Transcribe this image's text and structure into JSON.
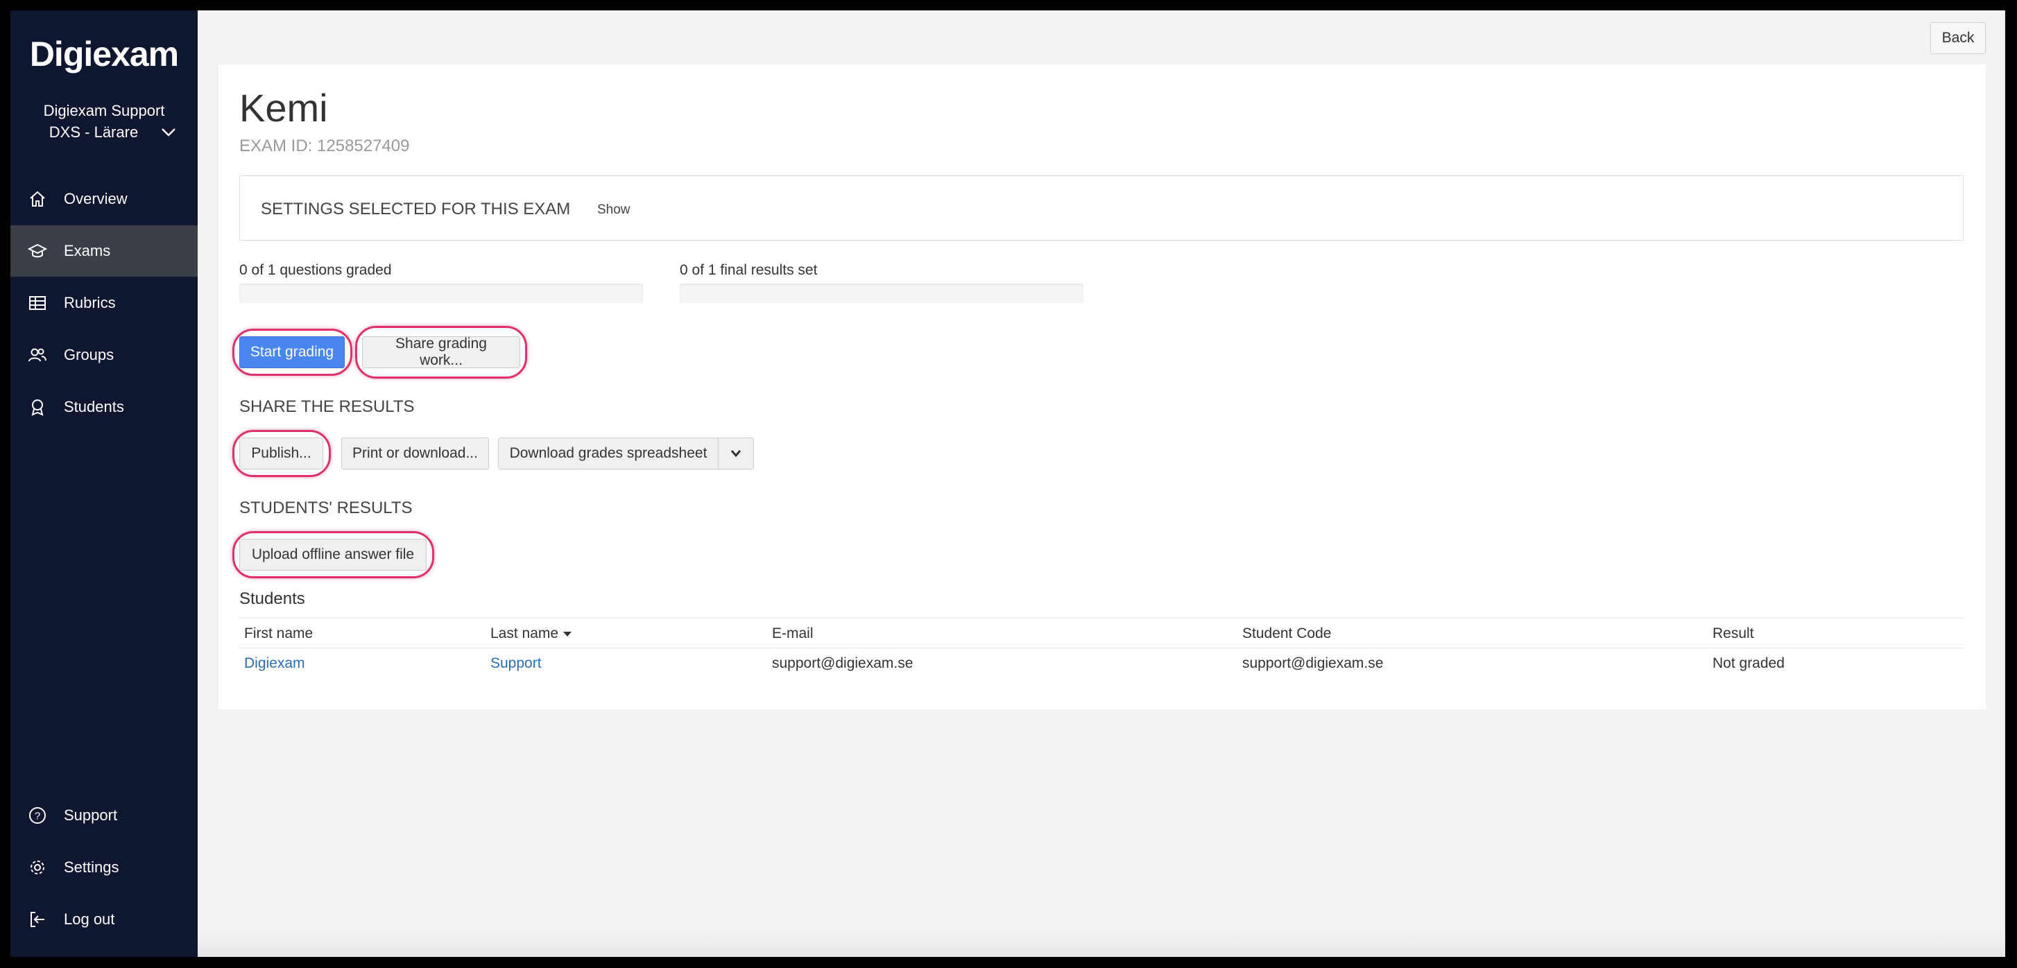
{
  "sidebar": {
    "logo": "Digiexam",
    "account_name": "Digiexam Support",
    "account_role": "DXS - Lärare",
    "nav": [
      {
        "label": "Overview",
        "icon": "home-icon"
      },
      {
        "label": "Exams",
        "icon": "graduation-cap-icon",
        "active": true
      },
      {
        "label": "Rubrics",
        "icon": "table-icon"
      },
      {
        "label": "Groups",
        "icon": "users-icon"
      },
      {
        "label": "Students",
        "icon": "student-icon"
      }
    ],
    "bottom_nav": [
      {
        "label": "Support",
        "icon": "help-icon"
      },
      {
        "label": "Settings",
        "icon": "gear-icon"
      },
      {
        "label": "Log out",
        "icon": "logout-icon"
      }
    ]
  },
  "header": {
    "back_label": "Back"
  },
  "exam": {
    "title": "Kemi",
    "id_text": "EXAM ID: 1258527409"
  },
  "settings": {
    "title": "SETTINGS SELECTED FOR THIS EXAM",
    "show_label": "Show"
  },
  "progress": {
    "questions_label": "0 of 1 questions graded",
    "questions_fraction": 0,
    "results_label": "0 of 1 final results set",
    "results_fraction": 0
  },
  "grading": {
    "start_label": "Start grading",
    "share_label": "Share grading work..."
  },
  "share_results": {
    "title": "SHARE THE RESULTS",
    "publish_label": "Publish...",
    "print_label": "Print or download...",
    "download_label": "Download grades spreadsheet"
  },
  "students_results": {
    "title": "STUDENTS' RESULTS",
    "upload_label": "Upload offline answer file"
  },
  "students": {
    "heading": "Students",
    "columns": [
      "First name",
      "Last name",
      "E-mail",
      "Student Code",
      "Result"
    ],
    "rows": [
      {
        "first_name": "Digiexam",
        "last_name": "Support",
        "email": "support@digiexam.se",
        "code": "support@digiexam.se",
        "result": "Not graded"
      }
    ]
  },
  "colors": {
    "sidebar_bg": "#0f1730",
    "primary": "#4a86f0",
    "highlight": "#e0306a",
    "link": "#2a6db3"
  }
}
